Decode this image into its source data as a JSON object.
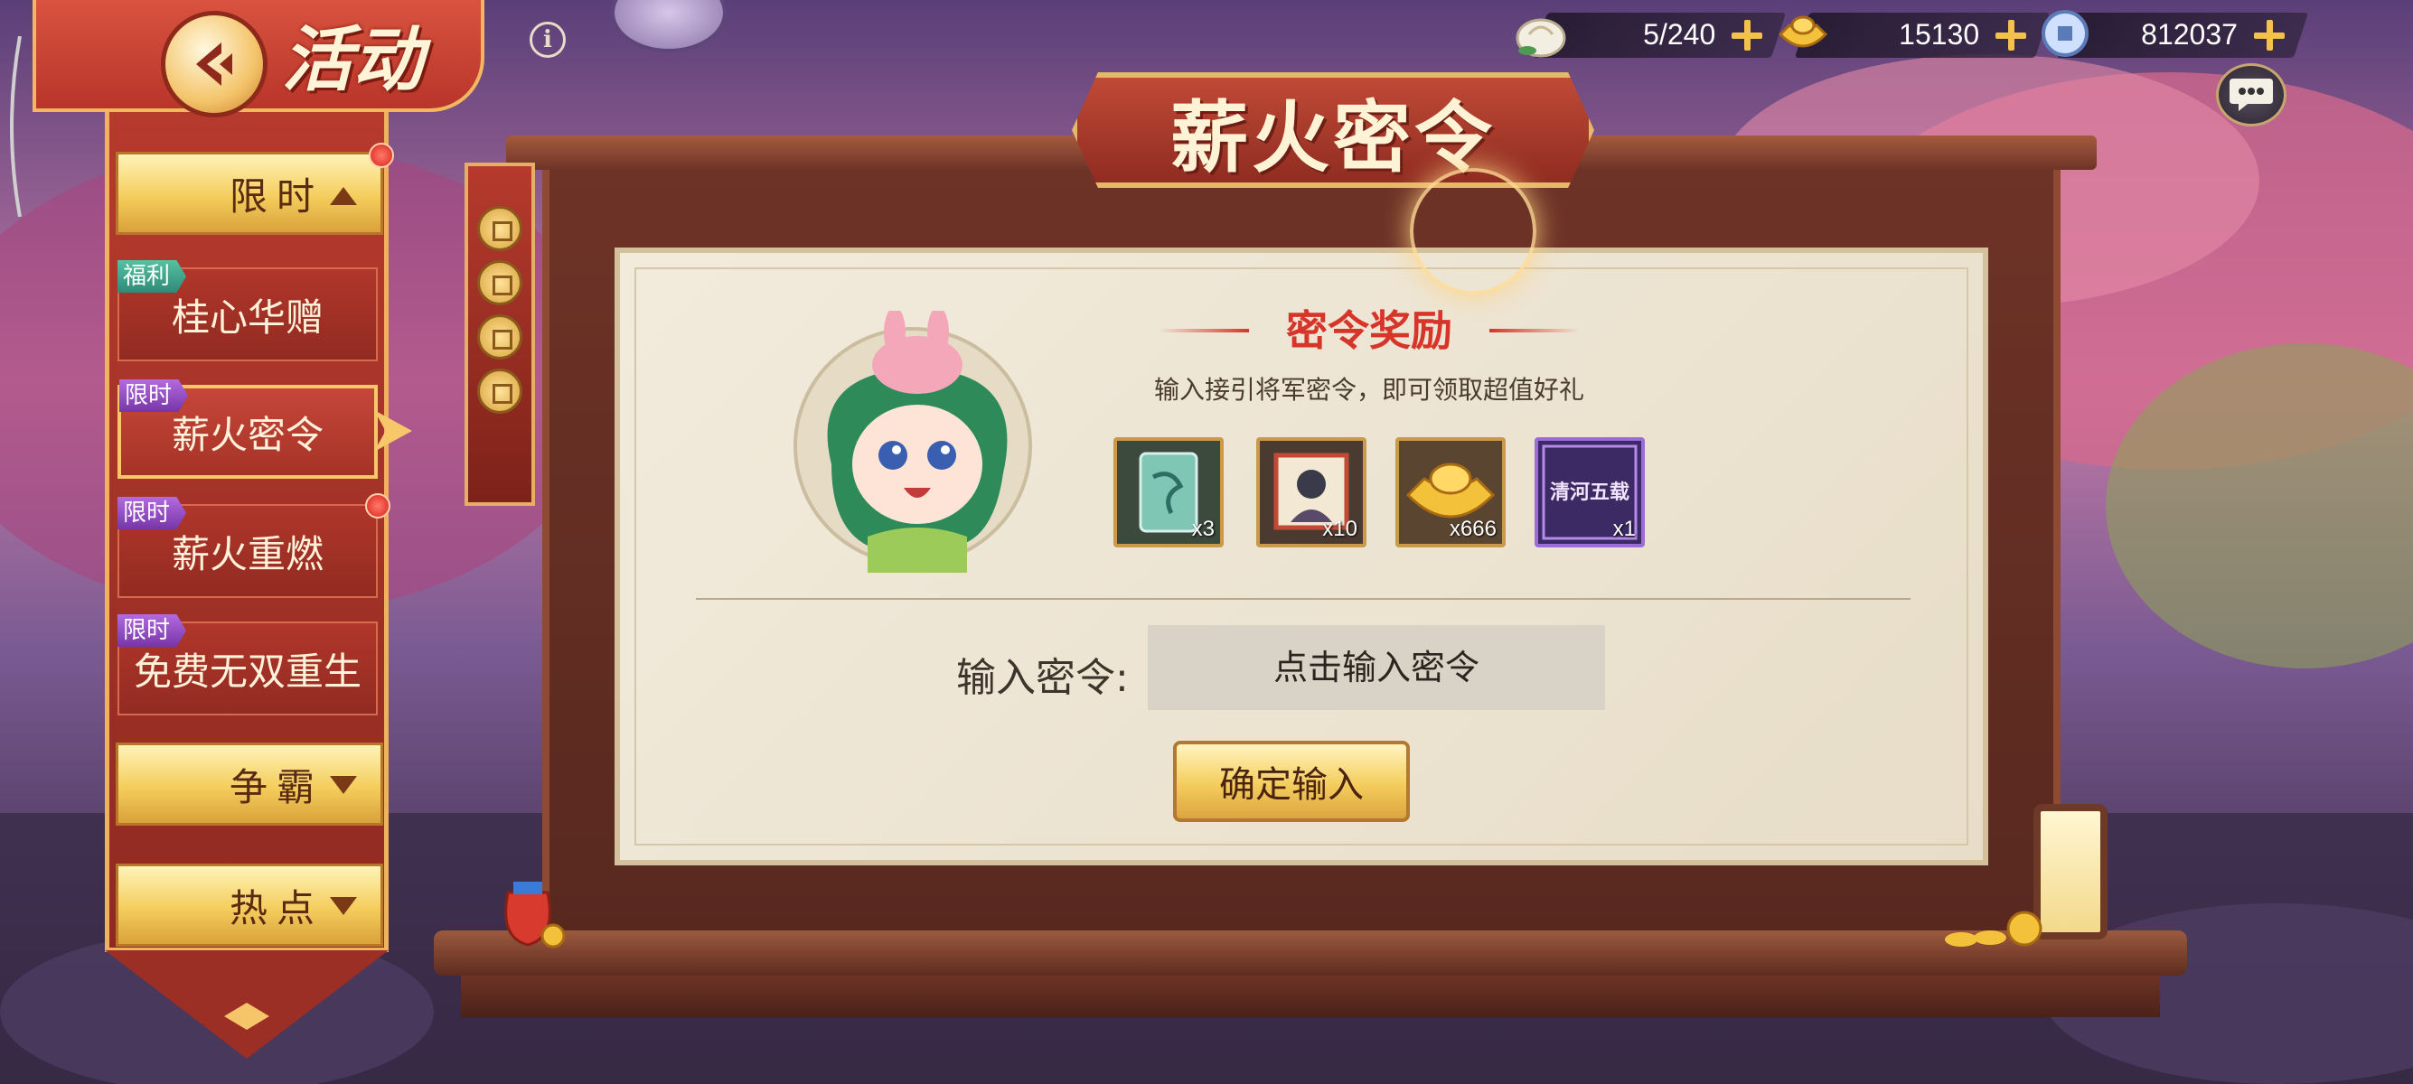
{
  "header": {
    "title": "活动",
    "back_icon": "back-arrow-icon",
    "info_symbol": "i"
  },
  "currencies": [
    {
      "icon": "bun-icon",
      "value": "5/240"
    },
    {
      "icon": "gold-ingot-icon",
      "value": "15130"
    },
    {
      "icon": "silver-coin-icon",
      "value": "812037"
    }
  ],
  "sidebar": {
    "categories": {
      "limited": "限时",
      "compete": "争霸",
      "hot": "热点"
    },
    "items": [
      {
        "badge": "福利",
        "label": "桂心华赠"
      },
      {
        "badge": "限时",
        "label": "薪火密令"
      },
      {
        "badge": "限时",
        "label": "薪火重燃"
      },
      {
        "badge": "限时",
        "label": "免费无双重生"
      }
    ]
  },
  "main": {
    "title": "薪火密令",
    "reward_title": "密令奖励",
    "reward_desc": "输入接引将军密令，即可领取超值好礼",
    "rewards": [
      {
        "icon": "scroll-card-icon",
        "qty": "x3"
      },
      {
        "icon": "portrait-scroll-icon",
        "qty": "x10"
      },
      {
        "icon": "gold-ingot-icon",
        "qty": "x666"
      },
      {
        "icon": "card-frame-icon",
        "qty": "x1",
        "art_text": "清河五载"
      }
    ],
    "input_label": "输入密令:",
    "input_placeholder": "点击输入密令",
    "confirm_label": "确定输入"
  },
  "colors": {
    "accent_red": "#d6352a",
    "gold": "#f4cd5c",
    "parchment": "#f2ebdc",
    "frame_brown": "#6e3327"
  }
}
